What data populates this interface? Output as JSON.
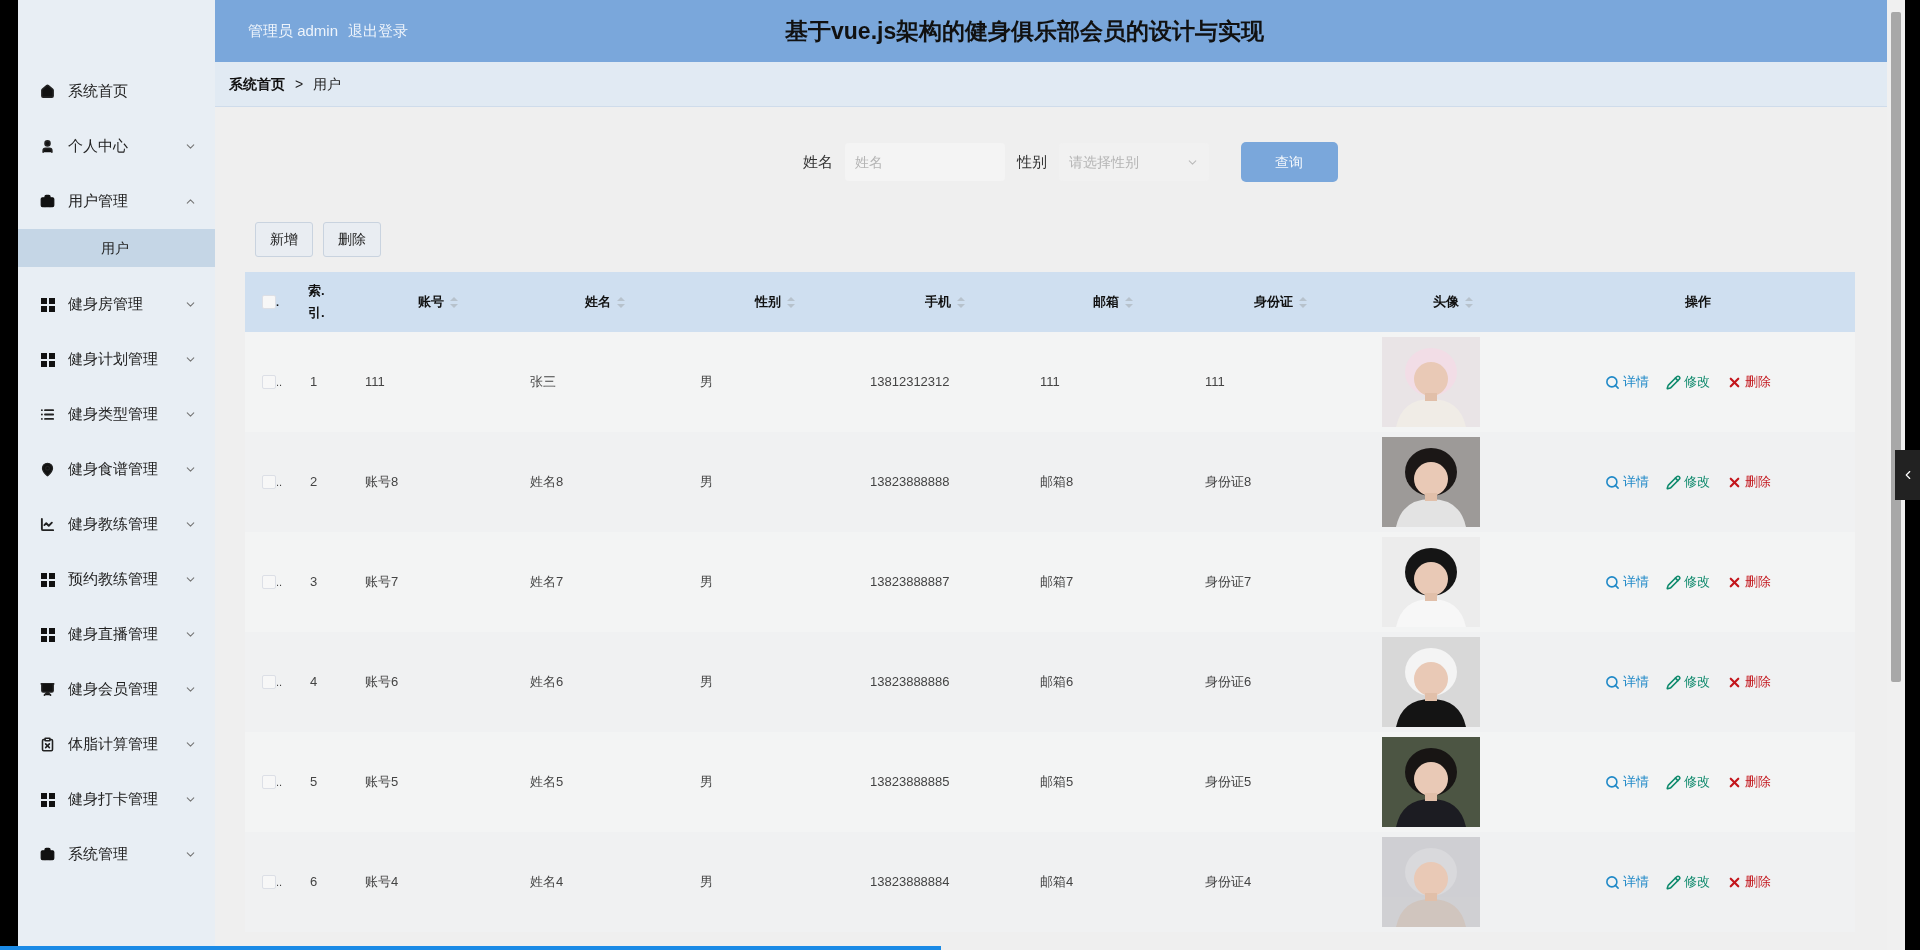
{
  "header": {
    "user_label": "管理员 admin",
    "logout": "退出登录",
    "title": "基于vue.js架构的健身俱乐部会员的设计与实现"
  },
  "sidebar": {
    "items": [
      {
        "label": "系统首页"
      },
      {
        "label": "个人中心",
        "expanded": false
      },
      {
        "label": "用户管理",
        "expanded": true,
        "children": [
          {
            "label": "用户",
            "selected": true
          }
        ]
      },
      {
        "label": "健身房管理",
        "expanded": false
      },
      {
        "label": "健身计划管理",
        "expanded": false
      },
      {
        "label": "健身类型管理",
        "expanded": false
      },
      {
        "label": "健身食谱管理",
        "expanded": false
      },
      {
        "label": "健身教练管理",
        "expanded": false
      },
      {
        "label": "预约教练管理",
        "expanded": false
      },
      {
        "label": "健身直播管理",
        "expanded": false
      },
      {
        "label": "健身会员管理",
        "expanded": false
      },
      {
        "label": "体脂计算管理",
        "expanded": false
      },
      {
        "label": "健身打卡管理",
        "expanded": false
      },
      {
        "label": "系统管理",
        "expanded": false
      }
    ]
  },
  "breadcrumb": [
    "系统首页",
    ">",
    "用户"
  ],
  "search": {
    "fields": [
      {
        "kind": "input",
        "label": "姓名",
        "placeholder": "姓名"
      },
      {
        "kind": "select",
        "label": "性别",
        "placeholder": "请选择性别"
      }
    ],
    "button": "查询"
  },
  "actions": [
    "新增",
    "删除"
  ],
  "table": {
    "select_all_checked": false,
    "select_label": ".",
    "columns": [
      {
        "label": "索.引.",
        "sortable": false
      },
      {
        "label": "账号",
        "sortable": true
      },
      {
        "label": "姓名",
        "sortable": true
      },
      {
        "label": "性别",
        "sortable": true
      },
      {
        "label": "手机",
        "sortable": true
      },
      {
        "label": "邮箱",
        "sortable": true
      },
      {
        "label": "身份证",
        "sortable": true
      },
      {
        "label": "头像",
        "sortable": true
      },
      {
        "label": "操作",
        "sortable": false
      }
    ],
    "rows": [
      {
        "checked": false,
        "check_label": "..",
        "cells": [
          "1",
          "111",
          "张三",
          "男",
          "13812312312",
          "111",
          "111"
        ],
        "ops": [
          "详情",
          "修改",
          "删除"
        ]
      },
      {
        "checked": false,
        "check_label": "..",
        "cells": [
          "2",
          "账号8",
          "姓名8",
          "男",
          "13823888888",
          "邮箱8",
          "身份证8"
        ],
        "ops": [
          "详情",
          "修改",
          "删除"
        ]
      },
      {
        "checked": false,
        "check_label": "..",
        "cells": [
          "3",
          "账号7",
          "姓名7",
          "男",
          "13823888887",
          "邮箱7",
          "身份证7"
        ],
        "ops": [
          "详情",
          "修改",
          "删除"
        ]
      },
      {
        "checked": false,
        "check_label": "..",
        "cells": [
          "4",
          "账号6",
          "姓名6",
          "男",
          "13823888886",
          "邮箱6",
          "身份证6"
        ],
        "ops": [
          "详情",
          "修改",
          "删除"
        ]
      },
      {
        "checked": false,
        "check_label": "..",
        "cells": [
          "5",
          "账号5",
          "姓名5",
          "男",
          "13823888885",
          "邮箱5",
          "身份证5"
        ],
        "ops": [
          "详情",
          "修改",
          "删除"
        ]
      },
      {
        "checked": false,
        "check_label": "..",
        "cells": [
          "6",
          "账号4",
          "姓名4",
          "男",
          "13823888884",
          "邮箱4",
          "身份证4"
        ],
        "ops": [
          "详情",
          "修改",
          "删除"
        ]
      }
    ]
  },
  "progress_bar": {
    "level": 0.49
  }
}
